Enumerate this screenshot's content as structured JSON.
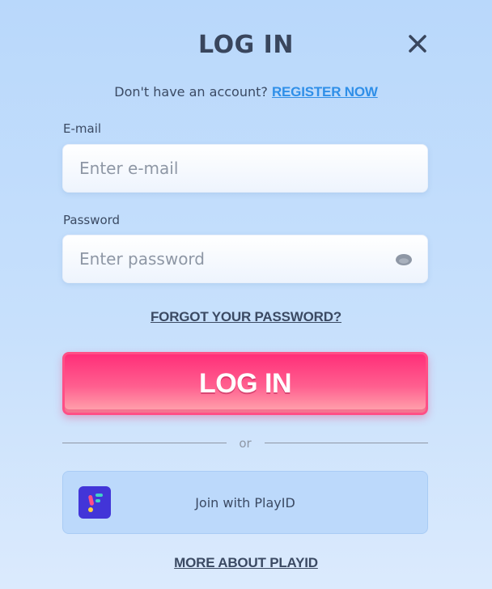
{
  "dialog": {
    "title": "LOG IN",
    "close_icon": "close-icon"
  },
  "register": {
    "prompt": "Don't have an account?",
    "link_label": "REGISTER NOW"
  },
  "email": {
    "label": "E-mail",
    "placeholder": "Enter e-mail",
    "value": ""
  },
  "password": {
    "label": "Password",
    "placeholder": "Enter password",
    "value": "",
    "toggle_icon": "eye-icon"
  },
  "forgot_label": "FORGOT YOUR PASSWORD?",
  "login_button": {
    "label": "LOG IN"
  },
  "divider_label": "or",
  "playid": {
    "label": "Join with PlayID",
    "logo_icon": "playid-logo-icon"
  },
  "more_label": "MORE ABOUT PLAYID",
  "colors": {
    "background": "#c7e0fc",
    "accent_link": "#2f8fe8",
    "login_button": "#ff2f79",
    "playid_logo": "#4235d8",
    "text": "#3b4a63"
  }
}
